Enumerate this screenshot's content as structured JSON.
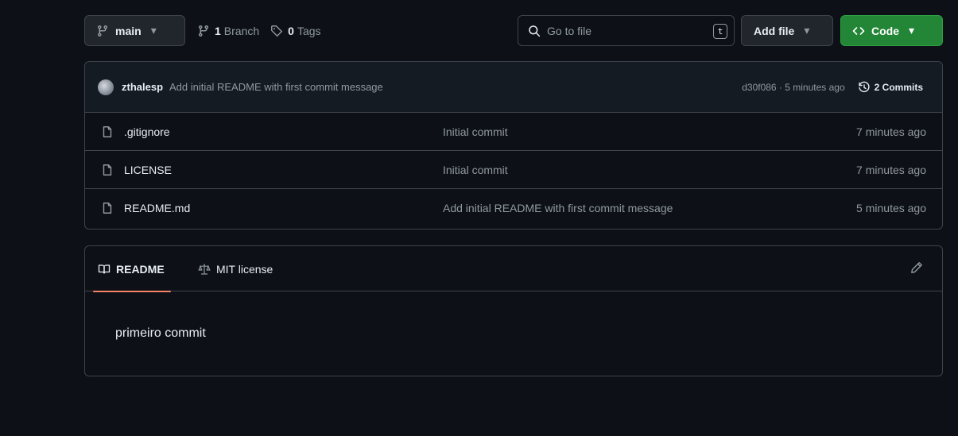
{
  "toolbar": {
    "branch": "main",
    "branch_count": "1",
    "branch_label": "Branch",
    "tag_count": "0",
    "tag_label": "Tags",
    "search_placeholder": "Go to file",
    "search_shortcut": "t",
    "add_file": "Add file",
    "code": "Code"
  },
  "commit": {
    "user": "zthalesp",
    "message": "Add initial README with first commit message",
    "hash_time": "d30f086 · 5 minutes ago",
    "commits_label": "2 Commits"
  },
  "files": [
    {
      "name": ".gitignore",
      "commit": "Initial commit",
      "age": "7 minutes ago"
    },
    {
      "name": "LICENSE",
      "commit": "Initial commit",
      "age": "7 minutes ago"
    },
    {
      "name": "README.md",
      "commit": "Add initial README with first commit message",
      "age": "5 minutes ago"
    }
  ],
  "readme": {
    "tab_readme": "README",
    "tab_license": "MIT license",
    "content": "primeiro commit"
  },
  "colors": {
    "background": "#0d1117",
    "border": "#3d444d",
    "code_button": "#238636",
    "active_tab_underline": "#f78166"
  }
}
